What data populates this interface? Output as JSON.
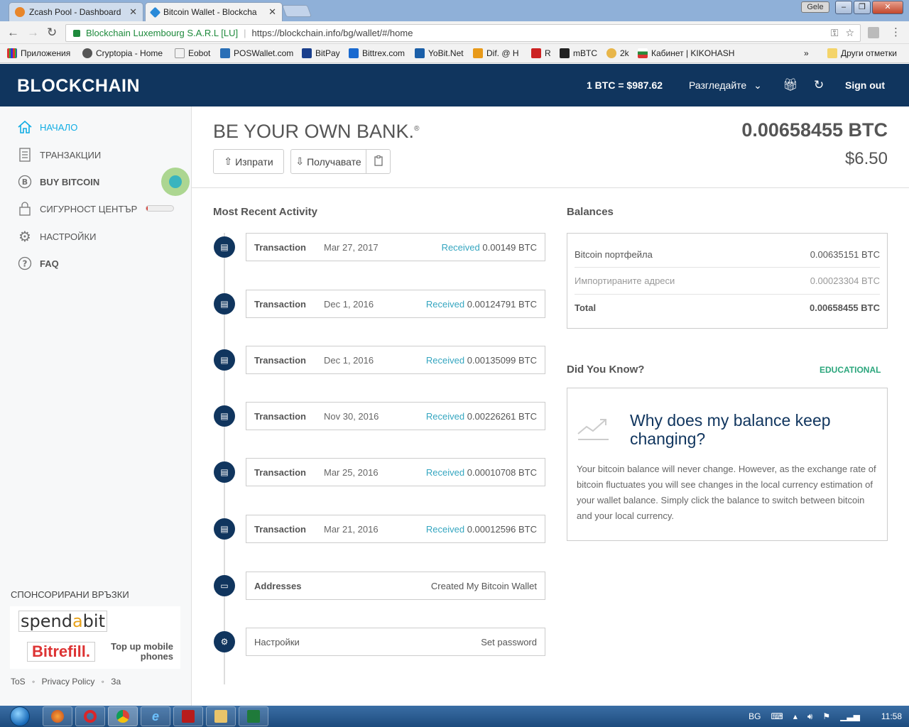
{
  "browser": {
    "tabs": [
      {
        "title": "Zcash Pool - Dashboard",
        "active": false,
        "color": "#e8862a"
      },
      {
        "title": "Bitcoin Wallet - Blockcha",
        "active": true,
        "color": "#2a8ad8"
      }
    ],
    "window_user": "Gele",
    "ev_cert": "Blockchain Luxembourg S.A.R.L [LU]",
    "url": "https://blockchain.info/bg/wallet/#/home",
    "bookmarks": [
      "Приложения",
      "Cryptopia - Home",
      "Eobot",
      "POSWallet.com",
      "BitPay",
      "Bittrex.com",
      "YoBit.Net",
      "Dif. @ H",
      "R",
      "mBTC",
      "2k",
      "Кабинет | KIKOHASH",
      "Други отметки"
    ]
  },
  "header": {
    "logo": "BLOCKCHAIN",
    "rate_label": "1 BTC =",
    "rate_value": "$987.62",
    "explore": "Разгледайте",
    "signout": "Sign out"
  },
  "sidebar": {
    "items": [
      {
        "label": "НАЧАЛО",
        "icon": "home-icon"
      },
      {
        "label": "ТРАНЗАКЦИИ",
        "icon": "list-icon"
      },
      {
        "label": "BUY BITCOIN",
        "icon": "bitcoin-icon"
      },
      {
        "label": "СИГУРНОСТ ЦЕНТЪР",
        "icon": "lock-icon"
      },
      {
        "label": "НАСТРОЙКИ",
        "icon": "gear-icon"
      },
      {
        "label": "FAQ",
        "icon": "question-icon"
      }
    ],
    "security_progress": 0.05,
    "sponsored_title": "СПОНСОРИРАНИ ВРЪЗКИ",
    "spendabit_pre": "spend",
    "spendabit_mid": "a",
    "spendabit_post": "bit",
    "bitrefill": "Bitrefill.",
    "topup": "Top up mobile phones",
    "footer": [
      "ToS",
      "Privacy Policy",
      "За"
    ]
  },
  "main": {
    "title": "BE YOUR OWN BANK.",
    "title_mark": "®",
    "send_label": "Изпрати",
    "receive_label": "Получавате",
    "balance_btc": "0.00658455 BTC",
    "balance_usd": "$6.50",
    "activity_title": "Most Recent Activity",
    "activity": [
      {
        "type": "Transaction",
        "date": "Mar 27, 2017",
        "status": "Received",
        "amount": "0.00149 BTC"
      },
      {
        "type": "Transaction",
        "date": "Dec 1, 2016",
        "status": "Received",
        "amount": "0.00124791 BTC"
      },
      {
        "type": "Transaction",
        "date": "Dec 1, 2016",
        "status": "Received",
        "amount": "0.00135099 BTC"
      },
      {
        "type": "Transaction",
        "date": "Nov 30, 2016",
        "status": "Received",
        "amount": "0.00226261 BTC"
      },
      {
        "type": "Transaction",
        "date": "Mar 25, 2016",
        "status": "Received",
        "amount": "0.00010708 BTC"
      },
      {
        "type": "Transaction",
        "date": "Mar 21, 2016",
        "status": "Received",
        "amount": "0.00012596 BTC"
      },
      {
        "type": "Addresses",
        "date": "",
        "status": "",
        "amount": "Created My Bitcoin Wallet"
      },
      {
        "type": "Настройки",
        "date": "",
        "status": "",
        "amount": "Set password"
      }
    ],
    "balances_title": "Balances",
    "balances": [
      {
        "label": "Bitcoin портфейла",
        "value": "0.00635151 BTC"
      },
      {
        "label": "Импортираните адреси",
        "value": "0.00023304 BTC"
      },
      {
        "label": "Total",
        "value": "0.00658455 BTC"
      }
    ],
    "dyk_title": "Did You Know?",
    "dyk_tag": "EDUCATIONAL",
    "dyk_heading": "Why does my balance keep changing?",
    "dyk_text": "Your bitcoin balance will never change. However, as the exchange rate of bitcoin fluctuates you will see changes in the local currency estimation of your wallet balance. Simply click the balance to switch between bitcoin and your local currency."
  },
  "taskbar": {
    "lang": "BG",
    "time": "11:58"
  },
  "colors": {
    "navy": "#10355e",
    "accent": "#10ADE4",
    "received": "#35a6c0",
    "educational": "#2ba67c"
  }
}
